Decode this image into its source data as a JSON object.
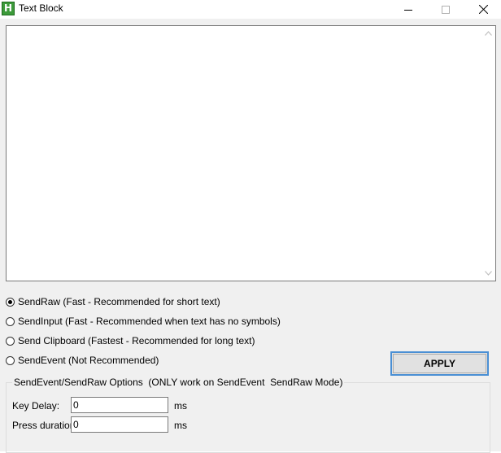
{
  "window": {
    "app_icon_letter": "H",
    "title": "Text Block",
    "controls": [
      "minimize-icon",
      "maximize-icon",
      "close-icon"
    ]
  },
  "editor": {
    "value": ""
  },
  "send_modes": [
    {
      "label": "SendRaw (Fast - Recommended for short text)",
      "selected": true
    },
    {
      "label": "SendInput (Fast - Recommended when text has no symbols)",
      "selected": false
    },
    {
      "label": "Send Clipboard (Fastest - Recommended for long text)",
      "selected": false
    },
    {
      "label": "SendEvent (Not Recommended)",
      "selected": false
    }
  ],
  "apply_label": "APPLY",
  "options": {
    "legend": "SendEvent/SendRaw Options  (ONLY work on SendEvent  SendRaw Mode)",
    "key_delay": {
      "label": "Key Delay:",
      "value": "0",
      "unit": "ms"
    },
    "press_duration": {
      "label": "Press duration:",
      "value": "0",
      "unit": "ms"
    }
  },
  "colors": {
    "accent": "#4a8fd4",
    "app_icon": "#3c9a3a",
    "dialog_bg": "#f0f0f0"
  }
}
